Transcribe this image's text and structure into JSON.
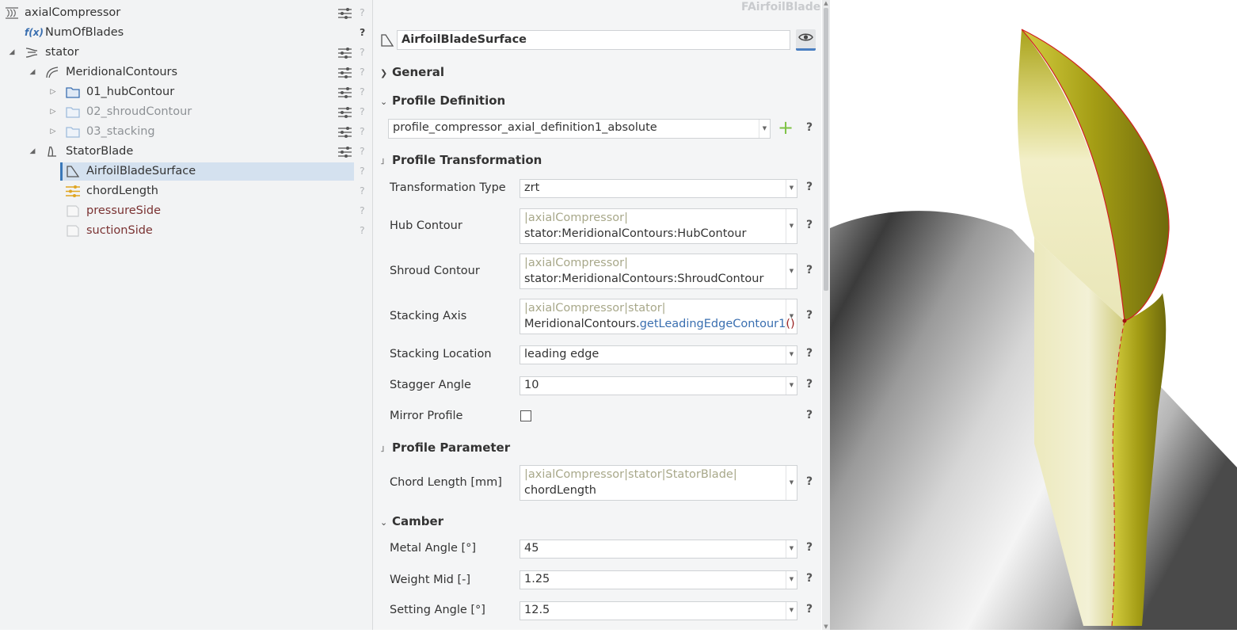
{
  "tree": {
    "items": [
      {
        "label": "axialCompressor",
        "icon": "compressor-icon",
        "twisty": "",
        "style": "normal"
      },
      {
        "label": "NumOfBlades",
        "icon": "function-icon",
        "icon_text": "f(x)",
        "twisty": "",
        "style": "normal"
      },
      {
        "label": "stator",
        "icon": "stator-icon",
        "twisty": "◢",
        "style": "normal"
      },
      {
        "label": "MeridionalContours",
        "icon": "contour-icon",
        "twisty": "◢",
        "style": "normal"
      },
      {
        "label": "01_hubContour",
        "icon": "folder-icon",
        "twisty": "▷",
        "style": "normal"
      },
      {
        "label": "02_shroudContour",
        "icon": "folder-icon",
        "twisty": "▷",
        "style": "faded"
      },
      {
        "label": "03_stacking",
        "icon": "folder-icon",
        "twisty": "▷",
        "style": "faded"
      },
      {
        "label": "StatorBlade",
        "icon": "blade-icon",
        "twisty": "◢",
        "style": "normal"
      },
      {
        "label": "AirfoilBladeSurface",
        "icon": "surface-icon",
        "twisty": "",
        "style": "selected"
      },
      {
        "label": "chordLength",
        "icon": "parameter-icon",
        "twisty": "",
        "style": "normal"
      },
      {
        "label": "pressureSide",
        "icon": "empty-surface-icon",
        "twisty": "",
        "style": "dark"
      },
      {
        "label": "suctionSide",
        "icon": "empty-surface-icon",
        "twisty": "",
        "style": "dark"
      }
    ],
    "help": "?"
  },
  "panel": {
    "class_name": "FAirfoilBlade",
    "object_name": "AirfoilBladeSurface",
    "help": "?",
    "sections": {
      "general": "General",
      "profile_definition": "Profile Definition",
      "profile_transformation": "Profile Transformation",
      "profile_parameter": "Profile Parameter",
      "camber": "Camber"
    },
    "profile_definition_value": "profile_compressor_axial_definition1_absolute",
    "transformation_type": {
      "label": "Transformation Type",
      "value": "zrt"
    },
    "hub_contour": {
      "label": "Hub Contour",
      "path": "|axialCompressor|",
      "value": "stator:MeridionalContours:HubContour"
    },
    "shroud_contour": {
      "label": "Shroud Contour",
      "path": "|axialCompressor|",
      "value": "stator:MeridionalContours:ShroudContour"
    },
    "stacking_axis": {
      "label": "Stacking Axis",
      "path": "|axialCompressor|stator|",
      "value_prefix": "MeridionalContours.",
      "value_fn": "getLeadingEdgeContour1",
      "value_paren": "()"
    },
    "stacking_location": {
      "label": "Stacking Location",
      "value": "leading edge"
    },
    "stagger_angle": {
      "label": "Stagger Angle",
      "value": "10"
    },
    "mirror_profile": {
      "label": "Mirror Profile",
      "checked": false
    },
    "chord_length": {
      "label": "Chord Length [mm]",
      "path": "|axialCompressor|stator|StatorBlade|",
      "value": "chordLength"
    },
    "metal_angle": {
      "label": "Metal Angle [°]",
      "value": "45"
    },
    "weight_mid": {
      "label": "Weight Mid  [-]",
      "value": "1.25"
    },
    "setting_angle": {
      "label": "Setting Angle [°]",
      "value": "12.5"
    }
  },
  "colors": {
    "accent": "#4a7fc1",
    "selection": "#d4e1ef",
    "blade_yellow": "#b5b01c",
    "add_green": "#7dc243"
  }
}
